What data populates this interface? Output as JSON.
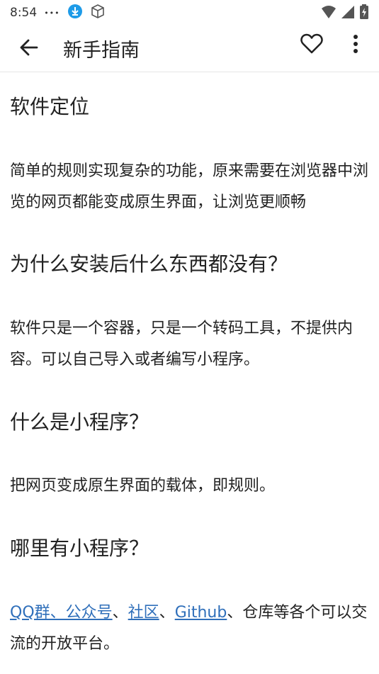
{
  "status_bar": {
    "time": "8:54",
    "dots": "•••"
  },
  "app_bar": {
    "title": "新手指南"
  },
  "sections": [
    {
      "heading": "软件定位",
      "body": "简单的规则实现复杂的功能，原来需要在浏览器中浏览的网页都能变成原生界面，让浏览更顺畅"
    },
    {
      "heading": "为什么安装后什么东西都没有？",
      "body": "软件只是一个容器，只是一个转码工具，不提供内容。可以自己导入或者编写小程序。"
    },
    {
      "heading": "什么是小程序？",
      "body": "把网页变成原生界面的载体，即规则。"
    },
    {
      "heading": "哪里有小程序？",
      "link1": "QQ群、公众号",
      "sep1": "、",
      "link2": "社区",
      "sep2": "、",
      "link3": "Github",
      "body_rest": "、仓库等各个可以交流的开放平台。"
    }
  ],
  "colors": {
    "link": "#2f6fba",
    "text": "#222222"
  }
}
